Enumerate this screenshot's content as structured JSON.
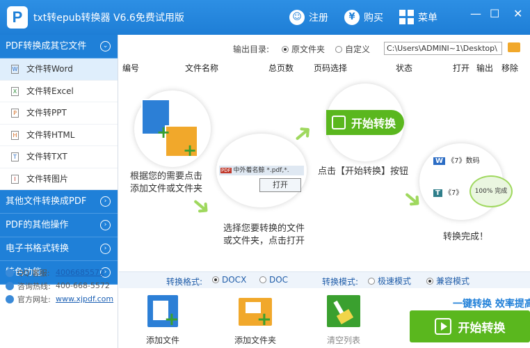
{
  "app": {
    "title": "txt转epub转换器 V6.6免费试用版",
    "logo": "P"
  },
  "titlebar": {
    "register": "注册",
    "buy": "购买",
    "menu": "菜单",
    "register_icon": "user-icon",
    "buy_icon": "yen-icon",
    "menu_icon": "grid-icon"
  },
  "sidebar": {
    "categories": [
      {
        "label": "PDF转换成其它文件",
        "expanded": true
      },
      {
        "label": "其他文件转换成PDF"
      },
      {
        "label": "PDF的其他操作"
      },
      {
        "label": "电子书格式转换"
      },
      {
        "label": "特色功能"
      }
    ],
    "items": [
      {
        "label": "文件转Word",
        "icon": "W"
      },
      {
        "label": "文件转Excel",
        "icon": "X"
      },
      {
        "label": "文件转PPT",
        "icon": "P"
      },
      {
        "label": "文件转HTML",
        "icon": "H"
      },
      {
        "label": "文件转TXT",
        "icon": "T"
      },
      {
        "label": "文件转图片",
        "icon": "I"
      }
    ]
  },
  "contact": {
    "qq_label": "QQ 客服:",
    "qq": "4006685572",
    "phone_label": "咨询热线:",
    "phone": "400-668-5572",
    "site_label": "官方网址:",
    "site": "www.xjpdf.com"
  },
  "output": {
    "label": "输出目录:",
    "opt_source": "原文件夹",
    "opt_custom": "自定义",
    "path": "C:\\Users\\ADMINI~1\\Desktop\\"
  },
  "table": {
    "headers": [
      "编号",
      "文件名称",
      "总页数",
      "页码选择",
      "状态",
      "打开",
      "输出",
      "移除"
    ]
  },
  "steps": {
    "step1": "根据您的需要点击\n添加文件或文件夹",
    "step2": "选择您要转换的文件\n或文件夹，点击打开",
    "step3": "点击【开始转换】按钮",
    "step4": "转换完成！",
    "start_label": "开始转换",
    "dialog_filename": "中外着名鲸",
    "dialog_ext": "*.pdf,*.",
    "open_label": "打开",
    "result1": "《7》数码",
    "result2": "《7》",
    "percent": "100%",
    "done": "完成"
  },
  "format": {
    "label": "转换格式:",
    "opt1": "DOCX",
    "opt2": "DOC",
    "mode_label": "转换模式:",
    "mode1": "极速模式",
    "mode2": "兼容模式"
  },
  "actions": {
    "add_file": "添加文件",
    "add_folder": "添加文件夹",
    "clear": "清空列表",
    "slogan": "一键转换  效率提高",
    "start": "开始转换"
  },
  "colors": {
    "brand": "#1f80d8",
    "accent_green": "#5ab71e"
  }
}
